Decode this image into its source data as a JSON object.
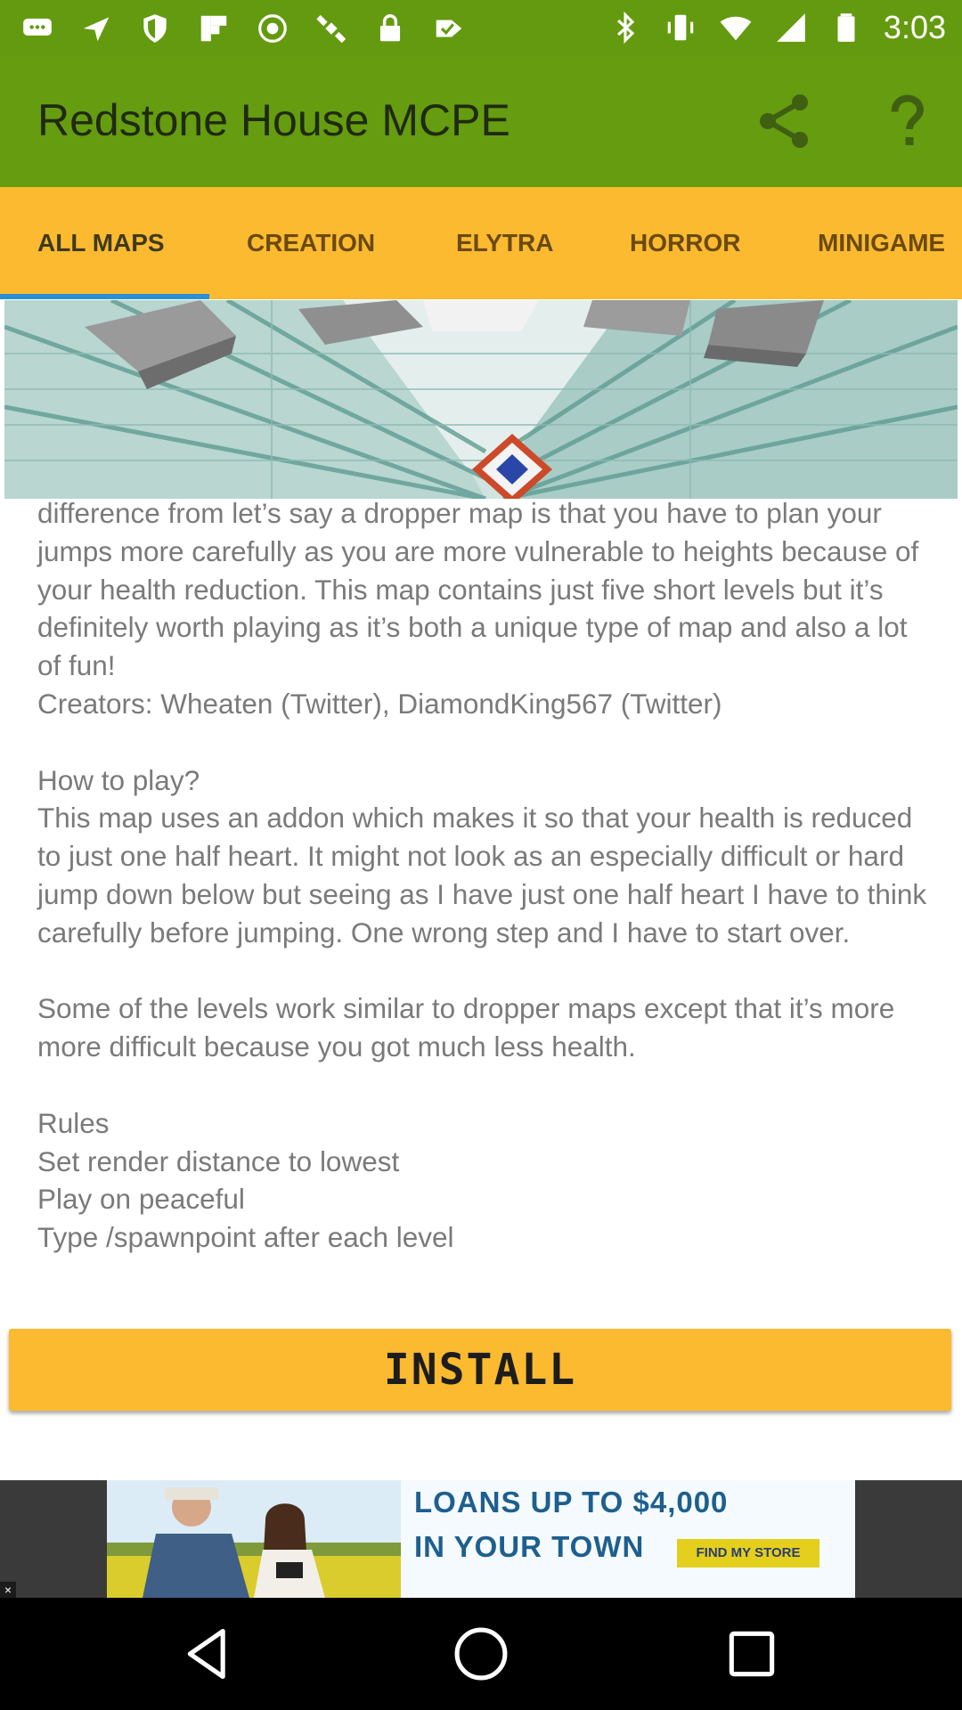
{
  "status_bar": {
    "time": "3:03",
    "left_icons": [
      "messages-icon",
      "navigation-icon",
      "shield-icon",
      "flipboard-icon",
      "app-icon",
      "satellite-icon",
      "lock-icon",
      "checkmark-icon"
    ],
    "right_icons": [
      "bluetooth-icon",
      "vibrate-icon",
      "wifi-icon",
      "signal-icon",
      "battery-icon"
    ]
  },
  "app_bar": {
    "title": "Redstone House MCPE",
    "share_icon": "share-icon",
    "help_icon": "help-icon",
    "color": "#669c10"
  },
  "tabs": {
    "items": [
      {
        "label": "ALL MAPS",
        "active": true
      },
      {
        "label": "CREATION",
        "active": false
      },
      {
        "label": "ELYTRA",
        "active": false
      },
      {
        "label": "HORROR",
        "active": false
      },
      {
        "label": "MINIGAME",
        "active": false
      }
    ],
    "color": "#fbba30",
    "indicator_color": "#2b8fd6"
  },
  "description": {
    "text": "difference from let’s say a dropper map is that you have to plan your jumps more carefully as you are more vulnerable to heights because of your health reduction. This map contains just five short levels but it’s definitely worth playing as it’s both a unique type of map and also a lot of fun!\nCreators: Wheaten (Twitter), DiamondKing567 (Twitter)\n\nHow to play?\nThis map uses an addon which makes it so that your health is reduced to just one half heart. It might not look as an especially difficult or hard jump down below but seeing as I have just one half heart I have to think carefully before jumping. One wrong step and I have to start over.\n\nSome of the levels work similar to dropper maps except that it’s more more difficult because you got much less health.\n\nRules\nSet render distance to lowest\nPlay on peaceful\nType /spawnpoint after each level"
  },
  "install": {
    "label": "INSTALL",
    "color": "#fbba30"
  },
  "ad": {
    "headline_line1": "LOANS UP TO $4,000",
    "headline_line2": "IN YOUR TOWN",
    "cta": "FIND MY STORE",
    "close": "×"
  },
  "nav_bar": {
    "icons": [
      "back-icon",
      "home-icon",
      "recents-icon"
    ]
  }
}
